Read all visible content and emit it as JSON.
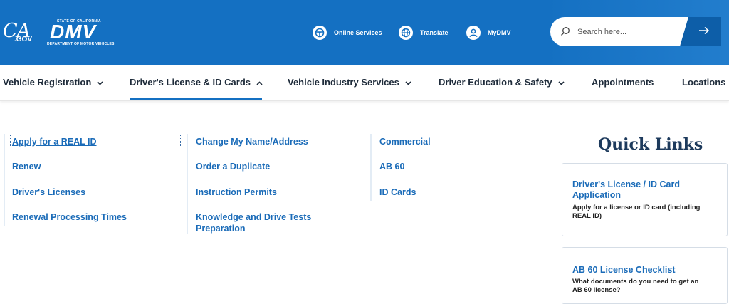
{
  "header": {
    "ca_logo": "CA",
    "ca_gov": ".GOV",
    "dmv_state": "STATE OF CALIFORNIA",
    "dmv_letters": "DMV",
    "dmv_dept": "DEPARTMENT OF MOTOR VEHICLES",
    "utilities": [
      {
        "label": "Online Services",
        "icon": "steering-wheel-icon"
      },
      {
        "label": "Translate",
        "icon": "globe-icon"
      },
      {
        "label": "MyDMV",
        "icon": "user-icon"
      }
    ],
    "search_placeholder": "Search here...",
    "colors": {
      "header_bg": "#1470c2",
      "search_button": "#0d5ea8"
    }
  },
  "nav": {
    "items": [
      {
        "label": "Vehicle Registration",
        "expanded": false
      },
      {
        "label": "Driver's License & ID Cards",
        "expanded": true
      },
      {
        "label": "Vehicle Industry Services",
        "expanded": false
      },
      {
        "label": "Driver Education & Safety",
        "expanded": false
      },
      {
        "label": "Appointments"
      },
      {
        "label": "Locations"
      }
    ]
  },
  "menu": {
    "col1": [
      "Apply for a REAL ID",
      "Renew",
      "Driver's Licenses",
      "Renewal Processing Times"
    ],
    "col2": [
      "Change My Name/Address",
      "Order a Duplicate",
      "Instruction Permits",
      "Knowledge and Drive Tests",
      "Preparation"
    ],
    "col3": [
      "Commercial",
      "AB 60",
      "ID Cards"
    ]
  },
  "quick_links": {
    "title": "Quick Links",
    "cards": [
      {
        "title_line1": "Driver's License / ID Card",
        "title_line2": "Application",
        "desc_line1": "Apply for a license or ID card (including",
        "desc_line2": "REAL ID)"
      },
      {
        "title_line1": "AB 60 License Checklist",
        "desc_line1": "What documents do you need to get an",
        "desc_line2": "AB 60 license?"
      }
    ]
  }
}
